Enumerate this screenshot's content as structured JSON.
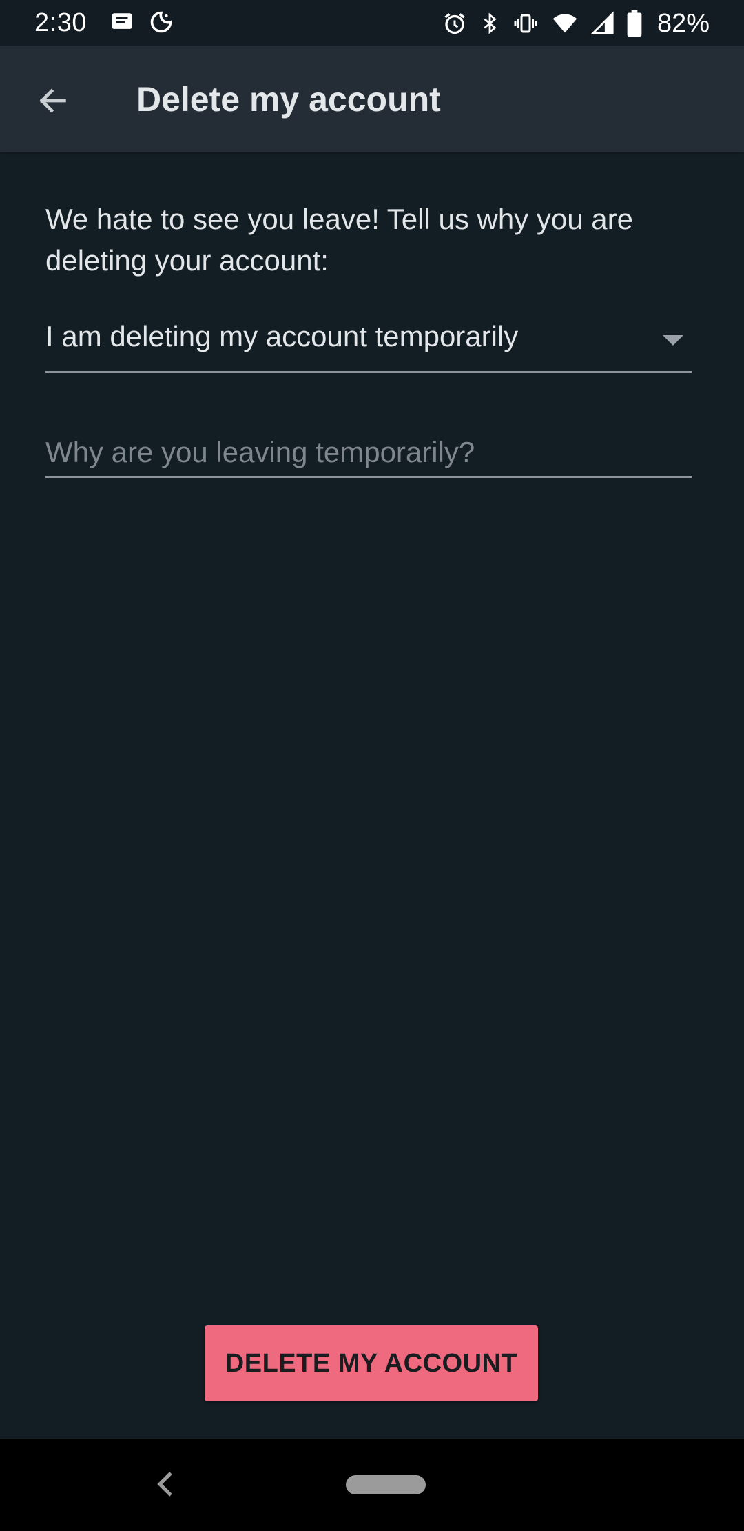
{
  "status_bar": {
    "time": "2:30",
    "battery_percent": "82%",
    "icons_left": [
      "message-icon",
      "do-not-disturb-moon-icon"
    ],
    "icons_right": [
      "alarm-icon",
      "bluetooth-icon",
      "vibrate-icon",
      "wifi-icon",
      "cell-signal-icon",
      "battery-icon"
    ]
  },
  "app_bar": {
    "title": "Delete my account",
    "back_icon": "arrow-back-icon"
  },
  "content": {
    "intro_text": "We hate to see you leave! Tell us why you are deleting your account:",
    "reason_dropdown": {
      "selected": "I am deleting my account temporarily"
    },
    "reason_input": {
      "value": "",
      "placeholder": "Why are you leaving temporarily?"
    }
  },
  "actions": {
    "delete_label": "DELETE MY ACCOUNT"
  },
  "colors": {
    "background": "#131d24",
    "app_bar": "#242d35",
    "accent_button": "#f06a7f"
  }
}
